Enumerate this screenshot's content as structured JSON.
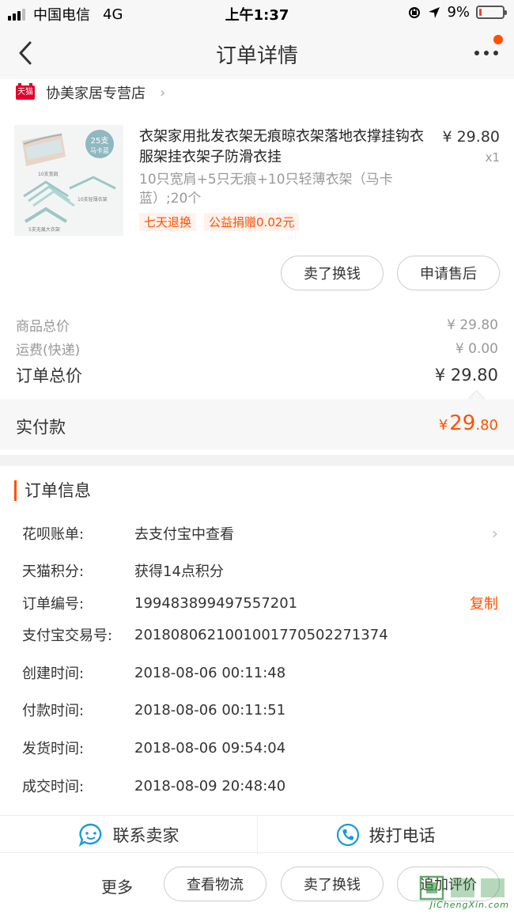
{
  "status_bar": {
    "carrier": "中国电信",
    "network": "4G",
    "time": "上午1:37",
    "battery_percent": "9%",
    "battery_level": 0.09
  },
  "nav": {
    "title": "订单详情"
  },
  "shop": {
    "logo_text": "天猫",
    "name": "协美家居专营店"
  },
  "product": {
    "image_text": {
      "count": "25支",
      "color": "马卡蓝",
      "label1": "10支宽肩",
      "label2": "10支轻薄衣架",
      "label3": "5支无痕大衣架"
    },
    "title": "衣架家用批发衣架无痕晾衣架落地衣撑挂钩衣服架挂衣架子防滑衣挂",
    "sku": "10只宽肩+5只无痕+10只轻薄衣架（马卡蓝）;20个",
    "tags": [
      "七天退换",
      "公益捐赠0.02元"
    ],
    "price": "¥ 29.80",
    "quantity": "x1"
  },
  "item_actions": {
    "sell_label": "卖了换钱",
    "aftersale_label": "申请售后"
  },
  "summary": {
    "goods_total_label": "商品总价",
    "goods_total_value": "¥ 29.80",
    "shipping_label": "运费(快递)",
    "shipping_value": "¥ 0.00",
    "order_total_label": "订单总价",
    "order_total_value": "¥ 29.80"
  },
  "paid": {
    "label": "实付款",
    "currency": "¥",
    "integer": "29",
    "decimal": ".80"
  },
  "order_info": {
    "heading": "订单信息",
    "rows": [
      {
        "key": "花呗账单:",
        "value": "去支付宝中查看"
      },
      {
        "key": "天猫积分:",
        "value": "获得14点积分"
      },
      {
        "key": "订单编号:",
        "value": "199483899497557201"
      },
      {
        "key": "支付宝交易号:",
        "value": "2018080621001001770502271374"
      },
      {
        "key": "创建时间:",
        "value": "2018-08-06 00:11:48"
      },
      {
        "key": "付款时间:",
        "value": "2018-08-06 00:11:51"
      },
      {
        "key": "发货时间:",
        "value": "2018-08-06 09:54:04"
      },
      {
        "key": "成交时间:",
        "value": "2018-08-09 20:48:40"
      }
    ],
    "copy_label": "复制"
  },
  "contact": {
    "seller_label": "联系卖家",
    "phone_label": "拨打电话"
  },
  "bottom_bar": {
    "more_label": "更多",
    "logistics_label": "查看物流",
    "sell_label": "卖了换钱",
    "review_label": "追加评价"
  },
  "watermark": {
    "text": "JiChengXin.com"
  },
  "colors": {
    "accent": "#ff5000",
    "tmall_red": "#e4002b",
    "contact_blue": "#1a9bdb"
  }
}
